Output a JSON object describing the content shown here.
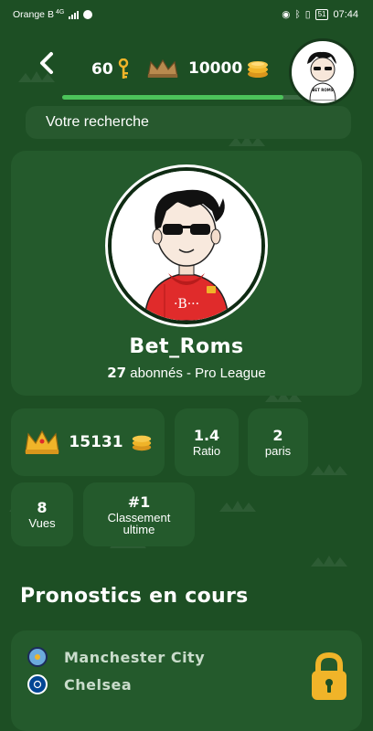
{
  "status_bar": {
    "carrier": "Orange B",
    "network": "4G",
    "battery": "51",
    "time": "07:44"
  },
  "header": {
    "keys_count": "60",
    "coins_count": "10000",
    "level_progress": 0.91
  },
  "search": {
    "placeholder": "Votre recherche"
  },
  "profile": {
    "username": "Bet_Roms",
    "followers_count": "27",
    "followers_label": " abonnés - Pro League",
    "avatar_logo_text": "BET ROMS"
  },
  "stats": {
    "score": "15131",
    "ratio_value": "1.4",
    "ratio_label": "Ratio",
    "bets_value": "2",
    "bets_label": "paris",
    "views_value": "8",
    "views_label": "Vues",
    "rank_value": "#1",
    "rank_label_line1": "Classement",
    "rank_label_line2": "ultime"
  },
  "predictions": {
    "title": "Pronostics en cours",
    "match": {
      "home_team": "Manchester City",
      "away_team": "Chelsea"
    }
  },
  "colors": {
    "background": "#1d4f24",
    "card": "#245a2c",
    "accent_green": "#4cc35a",
    "gold": "#f0b429"
  },
  "icons": [
    "back-arrow-icon",
    "key-icon",
    "crown-icon",
    "coins-icon",
    "lock-icon"
  ]
}
